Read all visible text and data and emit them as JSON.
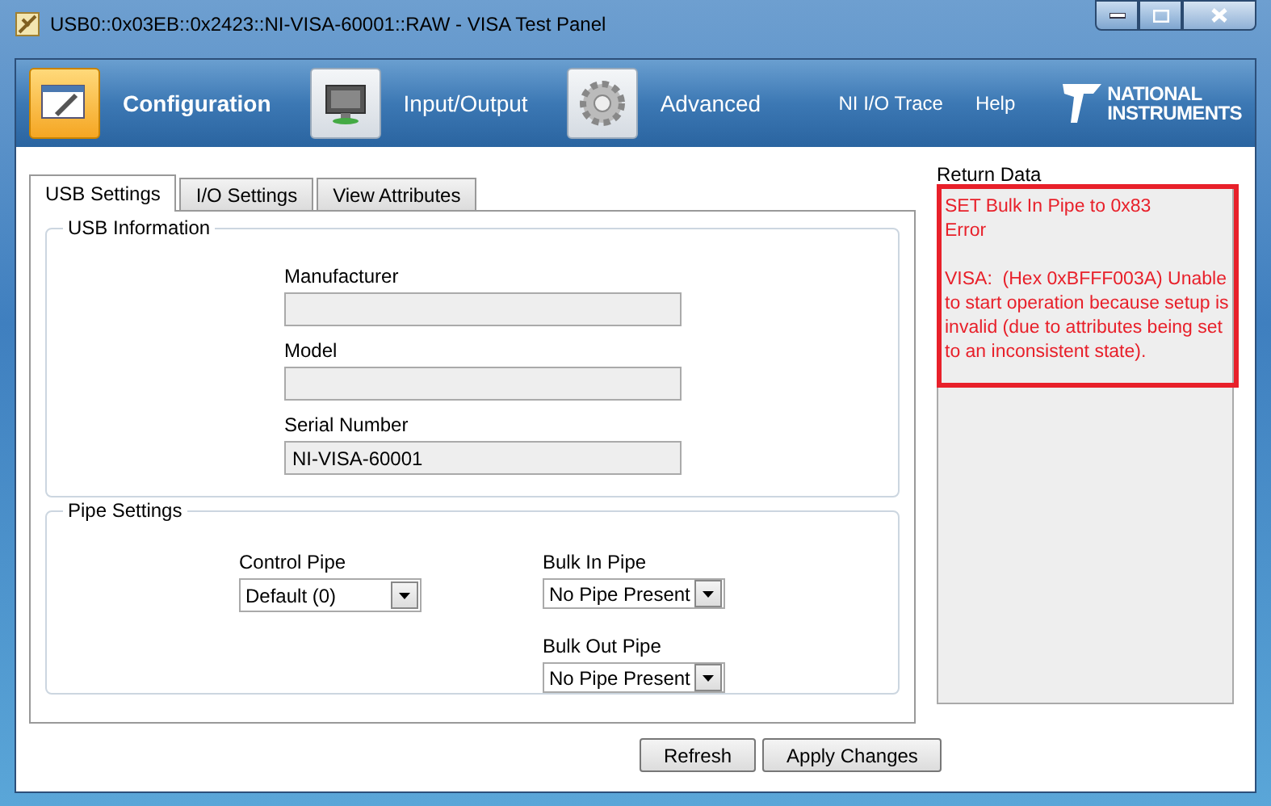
{
  "window": {
    "title": "USB0::0x03EB::0x2423::NI-VISA-60001::RAW - VISA Test Panel"
  },
  "nav": [
    {
      "label": "Configuration",
      "kind": "config",
      "selected": true
    },
    {
      "label": "Input/Output",
      "kind": "io",
      "selected": false
    },
    {
      "label": "Advanced",
      "kind": "gear",
      "selected": false
    }
  ],
  "links": [
    "NI I/O Trace",
    "Help"
  ],
  "logo": [
    "NATIONAL",
    "INSTRUMENTS"
  ],
  "tabs": [
    {
      "label": "USB Settings",
      "selected": true
    },
    {
      "label": "I/O Settings",
      "selected": false
    },
    {
      "label": "View Attributes",
      "selected": false
    }
  ],
  "usb_information": {
    "title": "USB Information",
    "fields": [
      {
        "label": "Manufacturer"
      },
      {
        "label": "Model"
      },
      {
        "label": "Serial Number",
        "value": "NI-VISA-60001"
      }
    ]
  },
  "pipe_settings": {
    "title": "Pipe Settings",
    "columns": [
      [
        {
          "label": "Control Pipe",
          "value": "Default (0)"
        }
      ],
      [
        {
          "label": "Bulk In Pipe",
          "value": "No Pipe Present"
        },
        {
          "label": "Bulk Out Pipe",
          "value": "No Pipe Present"
        }
      ]
    ]
  },
  "return_data": {
    "label": "Return Data",
    "paragraphs": [
      "SET Bulk In Pipe to 0x83\nError",
      "VISA:  (Hex 0xBFFF003A) Unable to start operation because setup is invalid (due to attributes being set to an inconsistent state)."
    ]
  },
  "buttons": [
    "Refresh",
    "Apply Changes"
  ]
}
